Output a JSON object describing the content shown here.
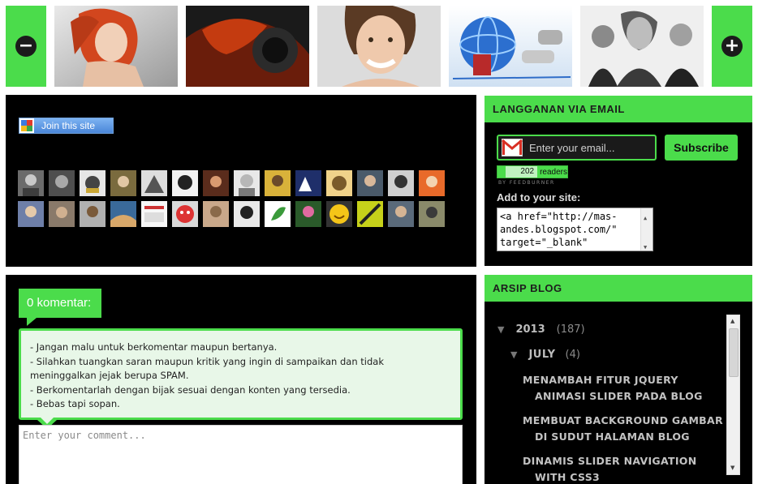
{
  "slider": {
    "prev_icon": "minus-circle-icon",
    "next_icon": "plus-circle-icon",
    "prev_glyph": "−",
    "next_glyph": "+"
  },
  "join": {
    "label": "Join this site",
    "icon": "google-friend-connect-icon"
  },
  "subscribe_widget": {
    "title": "LANGGANAN VIA EMAIL",
    "email_placeholder": "Enter your email...",
    "button_label": "Subscribe",
    "reader_count": "202",
    "reader_label": "readers",
    "byline": "BY FEEDBURNER",
    "add_label": "Add to your site:",
    "embed_code": "<a href=\"http://mas-andes.blogspot.com/\" target=\"_blank\""
  },
  "comments": {
    "header": "0 komentar:",
    "rules": [
      "- Jangan malu untuk berkomentar maupun bertanya.",
      "- Silahkan tuangkan saran maupun kritik yang ingin di sampaikan dan tidak meninggalkan jejak berupa SPAM.",
      "- Berkomentarlah dengan bijak sesuai dengan konten yang tersedia.",
      "- Bebas tapi sopan."
    ],
    "placeholder": "Enter your comment..."
  },
  "archive": {
    "title": "ARSIP BLOG",
    "year": "2013",
    "year_count": "(187)",
    "month": "JULY",
    "month_count": "(4)",
    "posts": [
      {
        "line1": "MENAMBAH FITUR JQUERY",
        "line2": "ANIMASI SLIDER PADA BLOG"
      },
      {
        "line1": "MEMBUAT BACKGROUND GAMBAR",
        "line2": "DI SUDUT HALAMAN BLOG"
      },
      {
        "line1": "DINAMIS SLIDER NAVIGATION",
        "line2": "WITH CSS3"
      }
    ]
  },
  "colors": {
    "accent": "#4bdc4b",
    "panel": "#000000"
  }
}
